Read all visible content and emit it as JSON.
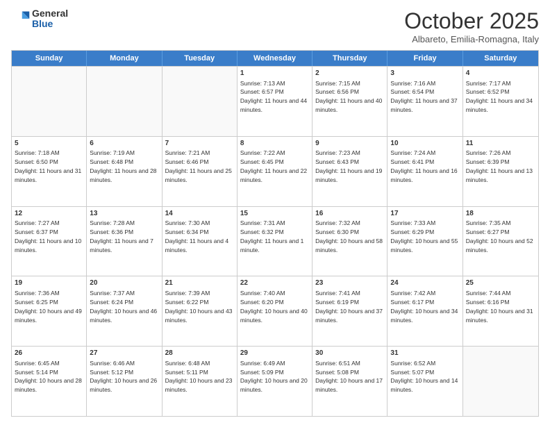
{
  "header": {
    "logo_general": "General",
    "logo_blue": "Blue",
    "month": "October 2025",
    "location": "Albareto, Emilia-Romagna, Italy"
  },
  "days": [
    "Sunday",
    "Monday",
    "Tuesday",
    "Wednesday",
    "Thursday",
    "Friday",
    "Saturday"
  ],
  "rows": [
    [
      {
        "day": "",
        "text": ""
      },
      {
        "day": "",
        "text": ""
      },
      {
        "day": "",
        "text": ""
      },
      {
        "day": "1",
        "text": "Sunrise: 7:13 AM\nSunset: 6:57 PM\nDaylight: 11 hours and 44 minutes."
      },
      {
        "day": "2",
        "text": "Sunrise: 7:15 AM\nSunset: 6:56 PM\nDaylight: 11 hours and 40 minutes."
      },
      {
        "day": "3",
        "text": "Sunrise: 7:16 AM\nSunset: 6:54 PM\nDaylight: 11 hours and 37 minutes."
      },
      {
        "day": "4",
        "text": "Sunrise: 7:17 AM\nSunset: 6:52 PM\nDaylight: 11 hours and 34 minutes."
      }
    ],
    [
      {
        "day": "5",
        "text": "Sunrise: 7:18 AM\nSunset: 6:50 PM\nDaylight: 11 hours and 31 minutes."
      },
      {
        "day": "6",
        "text": "Sunrise: 7:19 AM\nSunset: 6:48 PM\nDaylight: 11 hours and 28 minutes."
      },
      {
        "day": "7",
        "text": "Sunrise: 7:21 AM\nSunset: 6:46 PM\nDaylight: 11 hours and 25 minutes."
      },
      {
        "day": "8",
        "text": "Sunrise: 7:22 AM\nSunset: 6:45 PM\nDaylight: 11 hours and 22 minutes."
      },
      {
        "day": "9",
        "text": "Sunrise: 7:23 AM\nSunset: 6:43 PM\nDaylight: 11 hours and 19 minutes."
      },
      {
        "day": "10",
        "text": "Sunrise: 7:24 AM\nSunset: 6:41 PM\nDaylight: 11 hours and 16 minutes."
      },
      {
        "day": "11",
        "text": "Sunrise: 7:26 AM\nSunset: 6:39 PM\nDaylight: 11 hours and 13 minutes."
      }
    ],
    [
      {
        "day": "12",
        "text": "Sunrise: 7:27 AM\nSunset: 6:37 PM\nDaylight: 11 hours and 10 minutes."
      },
      {
        "day": "13",
        "text": "Sunrise: 7:28 AM\nSunset: 6:36 PM\nDaylight: 11 hours and 7 minutes."
      },
      {
        "day": "14",
        "text": "Sunrise: 7:30 AM\nSunset: 6:34 PM\nDaylight: 11 hours and 4 minutes."
      },
      {
        "day": "15",
        "text": "Sunrise: 7:31 AM\nSunset: 6:32 PM\nDaylight: 11 hours and 1 minute."
      },
      {
        "day": "16",
        "text": "Sunrise: 7:32 AM\nSunset: 6:30 PM\nDaylight: 10 hours and 58 minutes."
      },
      {
        "day": "17",
        "text": "Sunrise: 7:33 AM\nSunset: 6:29 PM\nDaylight: 10 hours and 55 minutes."
      },
      {
        "day": "18",
        "text": "Sunrise: 7:35 AM\nSunset: 6:27 PM\nDaylight: 10 hours and 52 minutes."
      }
    ],
    [
      {
        "day": "19",
        "text": "Sunrise: 7:36 AM\nSunset: 6:25 PM\nDaylight: 10 hours and 49 minutes."
      },
      {
        "day": "20",
        "text": "Sunrise: 7:37 AM\nSunset: 6:24 PM\nDaylight: 10 hours and 46 minutes."
      },
      {
        "day": "21",
        "text": "Sunrise: 7:39 AM\nSunset: 6:22 PM\nDaylight: 10 hours and 43 minutes."
      },
      {
        "day": "22",
        "text": "Sunrise: 7:40 AM\nSunset: 6:20 PM\nDaylight: 10 hours and 40 minutes."
      },
      {
        "day": "23",
        "text": "Sunrise: 7:41 AM\nSunset: 6:19 PM\nDaylight: 10 hours and 37 minutes."
      },
      {
        "day": "24",
        "text": "Sunrise: 7:42 AM\nSunset: 6:17 PM\nDaylight: 10 hours and 34 minutes."
      },
      {
        "day": "25",
        "text": "Sunrise: 7:44 AM\nSunset: 6:16 PM\nDaylight: 10 hours and 31 minutes."
      }
    ],
    [
      {
        "day": "26",
        "text": "Sunrise: 6:45 AM\nSunset: 5:14 PM\nDaylight: 10 hours and 28 minutes."
      },
      {
        "day": "27",
        "text": "Sunrise: 6:46 AM\nSunset: 5:12 PM\nDaylight: 10 hours and 26 minutes."
      },
      {
        "day": "28",
        "text": "Sunrise: 6:48 AM\nSunset: 5:11 PM\nDaylight: 10 hours and 23 minutes."
      },
      {
        "day": "29",
        "text": "Sunrise: 6:49 AM\nSunset: 5:09 PM\nDaylight: 10 hours and 20 minutes."
      },
      {
        "day": "30",
        "text": "Sunrise: 6:51 AM\nSunset: 5:08 PM\nDaylight: 10 hours and 17 minutes."
      },
      {
        "day": "31",
        "text": "Sunrise: 6:52 AM\nSunset: 5:07 PM\nDaylight: 10 hours and 14 minutes."
      },
      {
        "day": "",
        "text": ""
      }
    ]
  ]
}
